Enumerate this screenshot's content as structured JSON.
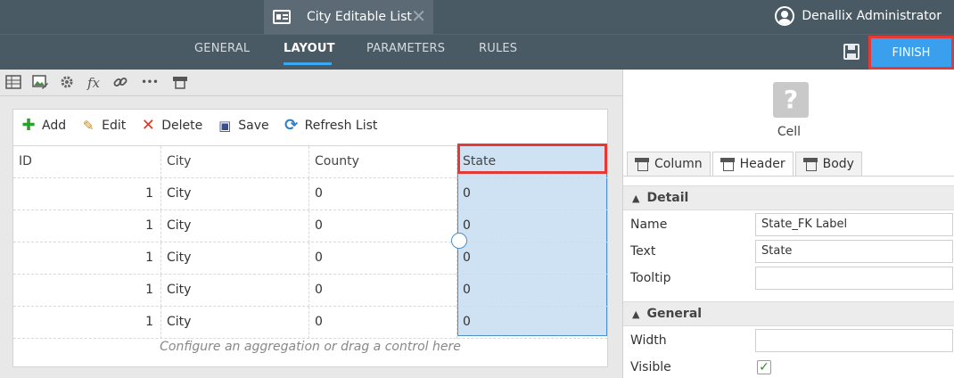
{
  "window": {
    "doc_tab_title": "City Editable List",
    "close_glyph": "✕",
    "user_name": "Denallix Administrator"
  },
  "nav": {
    "tabs": [
      {
        "label": "GENERAL"
      },
      {
        "label": "LAYOUT"
      },
      {
        "label": "PARAMETERS"
      },
      {
        "label": "RULES"
      }
    ],
    "active_tab": "LAYOUT",
    "finish_label": "FINISH"
  },
  "icon_toolbar": {
    "icons": [
      "grid-icon",
      "image-edit-icon",
      "settings-gear-icon",
      "fx-icon",
      "link-icon",
      "more-icon",
      "header-icon"
    ],
    "fx_glyph": "fx",
    "more_glyph": "•••"
  },
  "list_toolbar": {
    "add": "Add",
    "edit": "Edit",
    "delete": "Delete",
    "save": "Save",
    "refresh": "Refresh List"
  },
  "grid": {
    "columns": [
      "ID",
      "City",
      "County",
      "State"
    ],
    "rows": [
      [
        "1",
        "City",
        "0",
        "0"
      ],
      [
        "1",
        "City",
        "0",
        "0"
      ],
      [
        "1",
        "City",
        "0",
        "0"
      ],
      [
        "1",
        "City",
        "0",
        "0"
      ],
      [
        "1",
        "City",
        "0",
        "0"
      ]
    ],
    "footer_hint": "Configure an aggregation or drag a control here"
  },
  "properties": {
    "selected_label": "Cell",
    "selected_icon_glyph": "?",
    "tabs": [
      "Column",
      "Header",
      "Body"
    ],
    "active_tab": "Header",
    "detail": {
      "title": "Detail",
      "name_label": "Name",
      "name_value": "State_FK Label",
      "text_label": "Text",
      "text_value": "State",
      "tooltip_label": "Tooltip",
      "tooltip_value": ""
    },
    "general": {
      "title": "General",
      "width_label": "Width",
      "width_value": "",
      "visible_label": "Visible",
      "visible_checked": true
    }
  },
  "colors": {
    "topbar": "#4a5a65",
    "accent": "#3aa0ee",
    "highlight_border": "#e53935",
    "selection_fill": "#cfe2f3"
  }
}
